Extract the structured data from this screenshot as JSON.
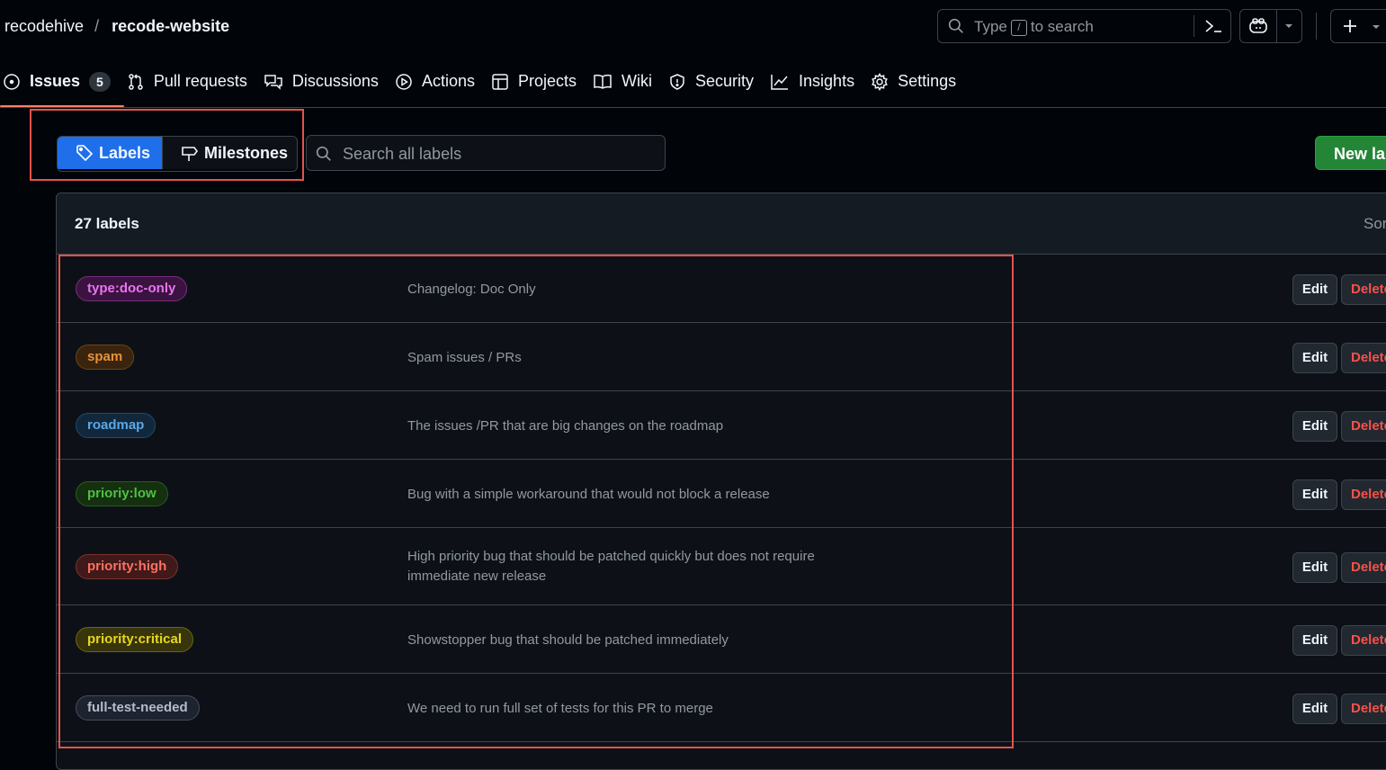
{
  "breadcrumb": {
    "owner": "recodehive",
    "separator": "/",
    "repo": "recode-website"
  },
  "global_search": {
    "prefix": "Type",
    "key": "/",
    "suffix": "to search"
  },
  "repo_nav": {
    "issues": {
      "label": "Issues",
      "count": "5"
    },
    "pull_requests": "Pull requests",
    "discussions": "Discussions",
    "actions": "Actions",
    "projects": "Projects",
    "wiki": "Wiki",
    "security": "Security",
    "insights": "Insights",
    "settings": "Settings"
  },
  "toolbar": {
    "labels_tab": "Labels",
    "milestones_tab": "Milestones",
    "search_placeholder": "Search all labels",
    "new_label_button": "New label"
  },
  "labels_list": {
    "count": "27 labels",
    "sort": "Sort",
    "edit": "Edit",
    "delete": "Delete",
    "items": [
      {
        "name": "type:doc-only",
        "description": "Changelog: Doc Only",
        "text_color": "#e875f0",
        "bg_color": "#3b1340",
        "border_color": "#7a2d80"
      },
      {
        "name": "spam",
        "description": "Spam issues / PRs",
        "text_color": "#e8913a",
        "bg_color": "#3a240d",
        "border_color": "#6d4515"
      },
      {
        "name": "roadmap",
        "description": "The issues /PR that are big changes on the roadmap",
        "text_color": "#5aa8e8",
        "bg_color": "#11283c",
        "border_color": "#1f4a6e"
      },
      {
        "name": "prioriy:low",
        "description": "Bug with a simple workaround that would not block a release",
        "text_color": "#4fbf45",
        "bg_color": "#14300f",
        "border_color": "#2a5a22"
      },
      {
        "name": "priority:high",
        "description": "High priority bug that should be patched quickly but does not require immediate new release",
        "text_color": "#ff7060",
        "bg_color": "#40191a",
        "border_color": "#7a3230"
      },
      {
        "name": "priority:critical",
        "description": "Showstopper bug that should be patched immediately",
        "text_color": "#e8d81a",
        "bg_color": "#38350d",
        "border_color": "#6b6515"
      },
      {
        "name": "full-test-needed",
        "description": "We need to run full set of tests for this PR to merge",
        "text_color": "#b5bccc",
        "bg_color": "#1e2330",
        "border_color": "#454c5c"
      }
    ]
  }
}
